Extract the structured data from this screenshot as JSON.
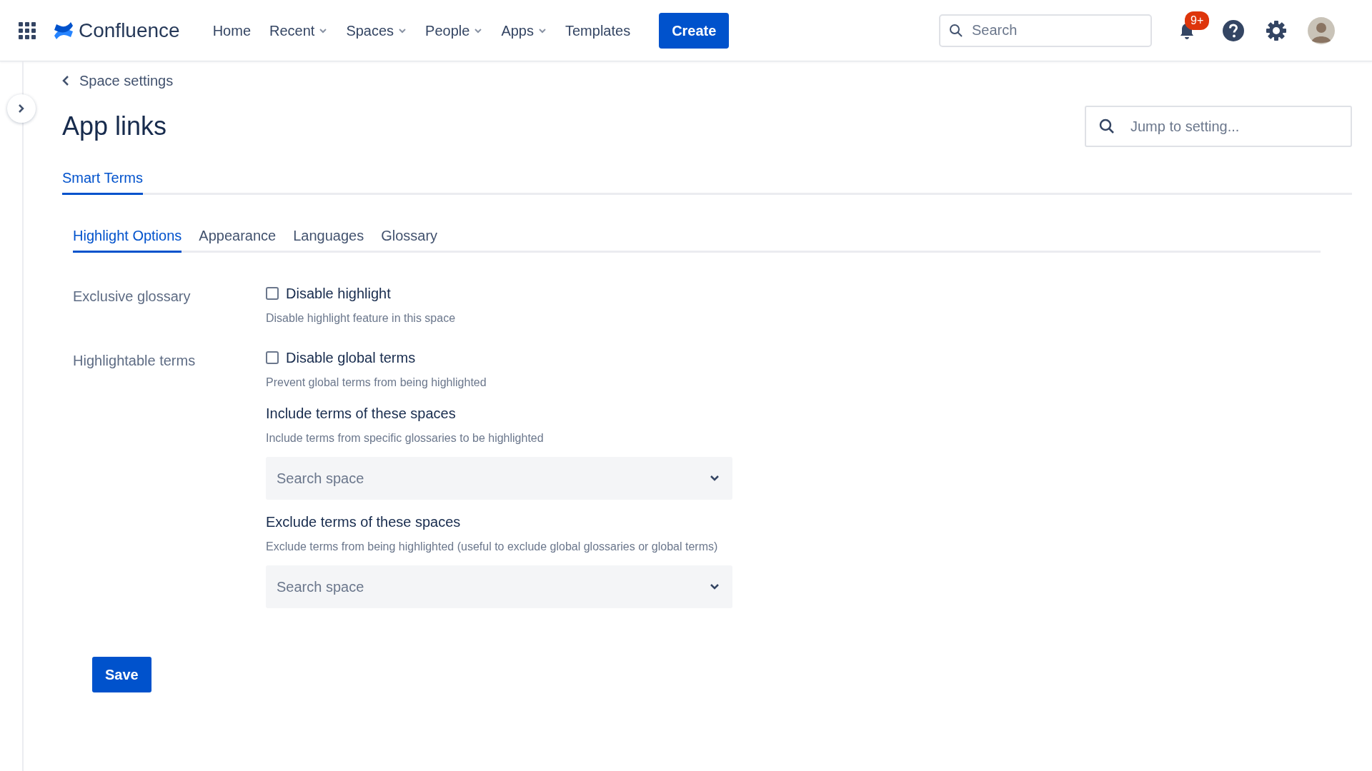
{
  "topbar": {
    "product": "Confluence",
    "nav": [
      {
        "label": "Home",
        "dropdown": false
      },
      {
        "label": "Recent",
        "dropdown": true
      },
      {
        "label": "Spaces",
        "dropdown": true
      },
      {
        "label": "People",
        "dropdown": true
      },
      {
        "label": "Apps",
        "dropdown": true
      },
      {
        "label": "Templates",
        "dropdown": false
      }
    ],
    "create": "Create",
    "search": {
      "placeholder": "Search"
    },
    "notifications": "9+"
  },
  "breadcrumb": "Space settings",
  "title": "App links",
  "jump": {
    "placeholder": "Jump to setting..."
  },
  "tabs": [
    {
      "label": "Smart Terms",
      "selected": true
    }
  ],
  "subtabs": [
    {
      "label": "Highlight Options",
      "selected": true
    },
    {
      "label": "Appearance",
      "selected": false
    },
    {
      "label": "Languages",
      "selected": false
    },
    {
      "label": "Glossary",
      "selected": false
    }
  ],
  "sections": [
    {
      "label": "Exclusive glossary",
      "items": [
        {
          "kind": "checkbox",
          "label": "Disable highlight",
          "checked": false,
          "help": "Disable highlight feature in this space"
        }
      ]
    },
    {
      "label": "Highlightable terms",
      "items": [
        {
          "kind": "checkbox",
          "label": "Disable global terms",
          "checked": false,
          "help": "Prevent global terms from being highlighted"
        },
        {
          "kind": "select",
          "label": "Include terms of these spaces",
          "help": "Include terms from specific glossaries to be highlighted",
          "placeholder": "Search space"
        },
        {
          "kind": "select",
          "label": "Exclude terms of these spaces",
          "help": "Exclude terms from being highlighted (useful to exclude global glossaries or global terms)",
          "placeholder": "Search space"
        }
      ]
    }
  ],
  "save": "Save"
}
